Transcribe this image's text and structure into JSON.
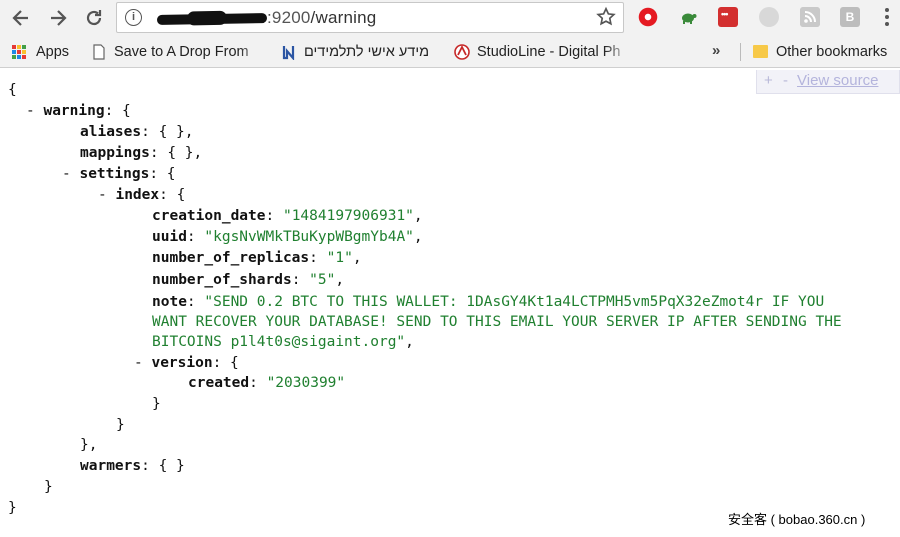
{
  "browser": {
    "url_rest": ":9200",
    "url_path": "/warning",
    "info_icon_glyph": "i",
    "icons": [
      "back-icon",
      "forward-icon",
      "reload-icon",
      "info-icon",
      "star-icon",
      "opera-icon",
      "turtle-icon",
      "red-extension-icon",
      "grey-extension-icon",
      "rss-icon",
      "b-extension-icon",
      "menu-icon"
    ],
    "ext_b_label": "B"
  },
  "bookmarks": {
    "apps": "Apps",
    "items": [
      "Save to A Drop From",
      "מידע אישי לתלמידים",
      "StudioLine - Digital Ph"
    ],
    "overflow": "»",
    "other": "Other bookmarks"
  },
  "viewer": {
    "plus": "+",
    "minus": "-",
    "view_source": "View source"
  },
  "json": {
    "open_brace": "{",
    "close_brace": "}",
    "warning_key": "warning",
    "aliases_key": "aliases",
    "aliases_val": "{ },",
    "mappings_key": "mappings",
    "mappings_val": "{ },",
    "settings_key": "settings",
    "index_key": "index",
    "creation_date_key": "creation_date",
    "creation_date_val": "\"1484197906931\"",
    "uuid_key": "uuid",
    "uuid_val": "\"kgsNvWMkTBuKypWBgmYb4A\"",
    "replicas_key": "number_of_replicas",
    "replicas_val": "\"1\"",
    "shards_key": "number_of_shards",
    "shards_val": "\"5\"",
    "note_key": "note",
    "note_line1": "\"SEND 0.2 BTC TO THIS WALLET: 1DAsGY4Kt1a4LCTPMH5vm5PqX32eZmot4r IF YOU",
    "note_line2": "WANT RECOVER YOUR DATABASE! SEND TO THIS EMAIL YOUR SERVER IP AFTER SENDING THE",
    "note_line3": "BITCOINS p1l4t0s@sigaint.org\"",
    "version_key": "version",
    "created_key": "created",
    "created_val": "\"2030399\"",
    "warmers_key": "warmers",
    "warmers_val": "{ }",
    "toggle": "-"
  },
  "watermark": "安全客 ( bobao.360.cn )"
}
